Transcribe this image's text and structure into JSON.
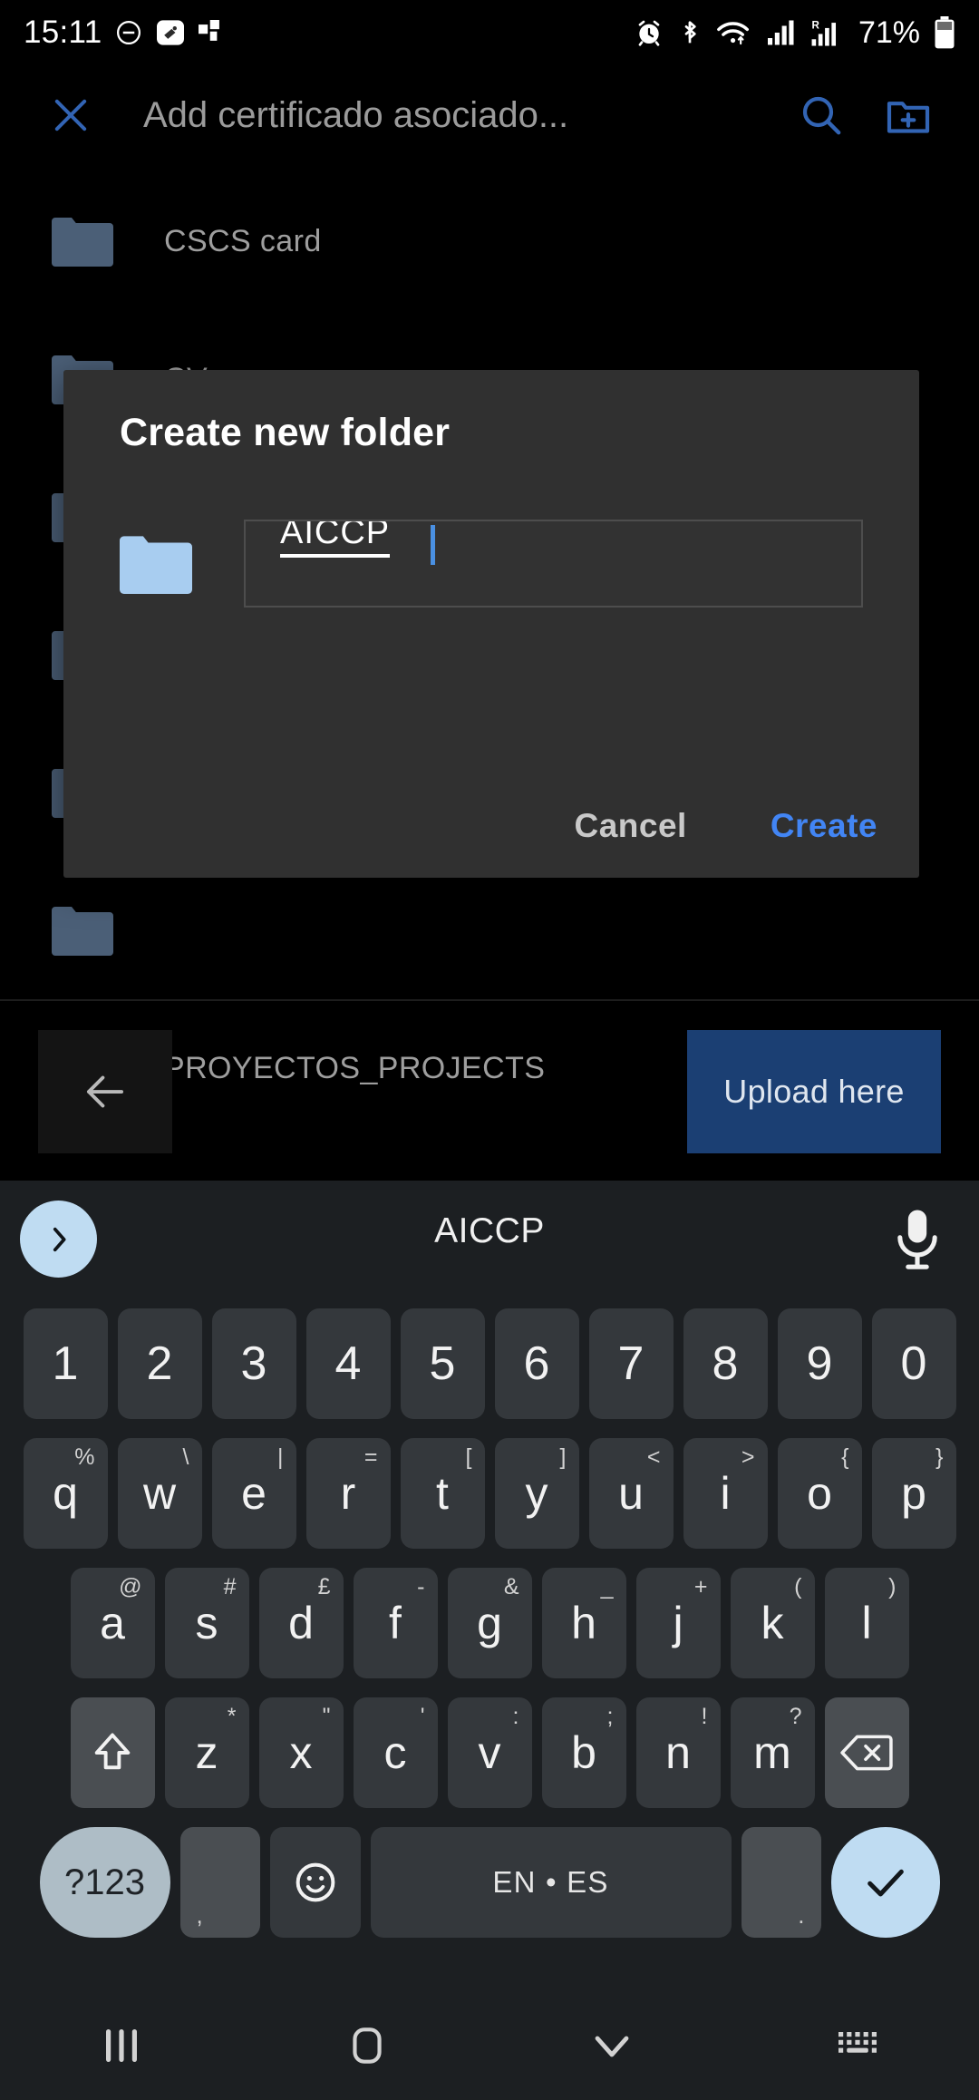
{
  "status_bar": {
    "time": "15:11",
    "battery_percent": "71%",
    "left_icons": [
      "dnd-icon",
      "screen-recorder-icon",
      "app-badge-icon"
    ],
    "right_icons": [
      "alarm-icon",
      "bluetooth-icon",
      "wifi-icon",
      "signal-icon",
      "roaming-signal-icon"
    ],
    "colors": {
      "text": "#ffffff",
      "background": "#000000"
    }
  },
  "app_bar": {
    "close_label": "close-icon",
    "title": "Add certificado asociado...",
    "search_label": "search-icon",
    "new_folder_label": "new-folder-icon",
    "accent": "#2f5da6"
  },
  "file_list": {
    "items": [
      {
        "name": "CSCS card"
      },
      {
        "name": "CV"
      },
      {
        "name": ""
      },
      {
        "name": ""
      },
      {
        "name": ""
      },
      {
        "name": ""
      },
      {
        "name": "PROYECTOS_PROJECTS"
      }
    ]
  },
  "dialog": {
    "title": "Create new folder",
    "folder_icon": "folder-icon",
    "input_value": "AICCP",
    "input_placeholder": "",
    "cancel_label": "Cancel",
    "create_label": "Create",
    "create_color": "#4285f4",
    "background": "#303030"
  },
  "action_bar": {
    "back_label": "back-arrow-icon",
    "upload_label": "Upload here",
    "upload_color": "#1b3f73"
  },
  "keyboard": {
    "suggestion": "AICCP",
    "expand_icon": "chevron-right-icon",
    "mic_icon": "microphone-icon",
    "rows": {
      "numbers": [
        {
          "main": "1"
        },
        {
          "main": "2"
        },
        {
          "main": "3"
        },
        {
          "main": "4"
        },
        {
          "main": "5"
        },
        {
          "main": "6"
        },
        {
          "main": "7"
        },
        {
          "main": "8"
        },
        {
          "main": "9"
        },
        {
          "main": "0"
        }
      ],
      "row1": [
        {
          "main": "q",
          "sup": "%"
        },
        {
          "main": "w",
          "sup": "\\"
        },
        {
          "main": "e",
          "sup": "|"
        },
        {
          "main": "r",
          "sup": "="
        },
        {
          "main": "t",
          "sup": "["
        },
        {
          "main": "y",
          "sup": "]"
        },
        {
          "main": "u",
          "sup": "<"
        },
        {
          "main": "i",
          "sup": ">"
        },
        {
          "main": "o",
          "sup": "{"
        },
        {
          "main": "p",
          "sup": "}"
        }
      ],
      "row2": [
        {
          "main": "a",
          "sup": "@"
        },
        {
          "main": "s",
          "sup": "#"
        },
        {
          "main": "d",
          "sup": "£"
        },
        {
          "main": "f",
          "sup": "-"
        },
        {
          "main": "g",
          "sup": "&"
        },
        {
          "main": "h",
          "sup": "_"
        },
        {
          "main": "j",
          "sup": "+"
        },
        {
          "main": "k",
          "sup": "("
        },
        {
          "main": "l",
          "sup": ")"
        }
      ],
      "row3": [
        {
          "main": "z",
          "sup": "*"
        },
        {
          "main": "x",
          "sup": "\""
        },
        {
          "main": "c",
          "sup": "'"
        },
        {
          "main": "v",
          "sup": ":"
        },
        {
          "main": "b",
          "sup": ";"
        },
        {
          "main": "n",
          "sup": "!"
        },
        {
          "main": "m",
          "sup": "?"
        }
      ]
    },
    "shift_label": "shift-icon",
    "delete_label": "backspace-icon",
    "symbols_label": "?123",
    "comma_label": ",",
    "emoji_label": "emoji-icon",
    "space_label": "EN • ES",
    "period_label": ".",
    "enter_label": "check-icon",
    "enter_color": "#bfdcf2"
  },
  "nav_bar": {
    "recents_label": "recents-icon",
    "home_label": "home-icon",
    "hide_keyboard_label": "chevron-down-icon",
    "keyboard_switch_label": "keyboard-switch-icon"
  }
}
